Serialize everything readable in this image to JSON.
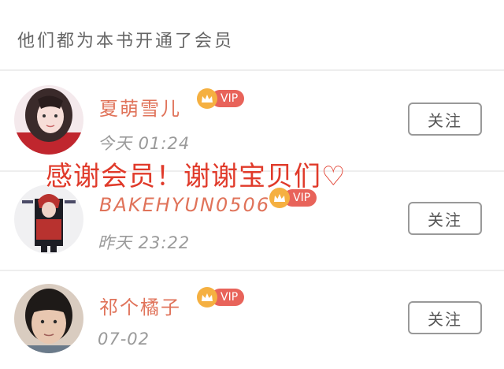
{
  "header": {
    "title": "他们都为本书开通了会员"
  },
  "overlay": {
    "text": "感谢会员！谢谢宝贝们♡"
  },
  "badge": {
    "label": "VIP"
  },
  "members": [
    {
      "name": "夏萌雪儿",
      "time": "今天 01:24",
      "follow_label": "关注"
    },
    {
      "name": "BAKEHYUN0506",
      "time": "昨天 23:22",
      "follow_label": "关注"
    },
    {
      "name": "祁个橘子",
      "time": "07-02",
      "follow_label": "关注"
    }
  ],
  "colors": {
    "name": "#e0735a",
    "vip_badge": "#e8635a",
    "crown": "#f5b041",
    "overlay_text": "#e03a2a"
  }
}
